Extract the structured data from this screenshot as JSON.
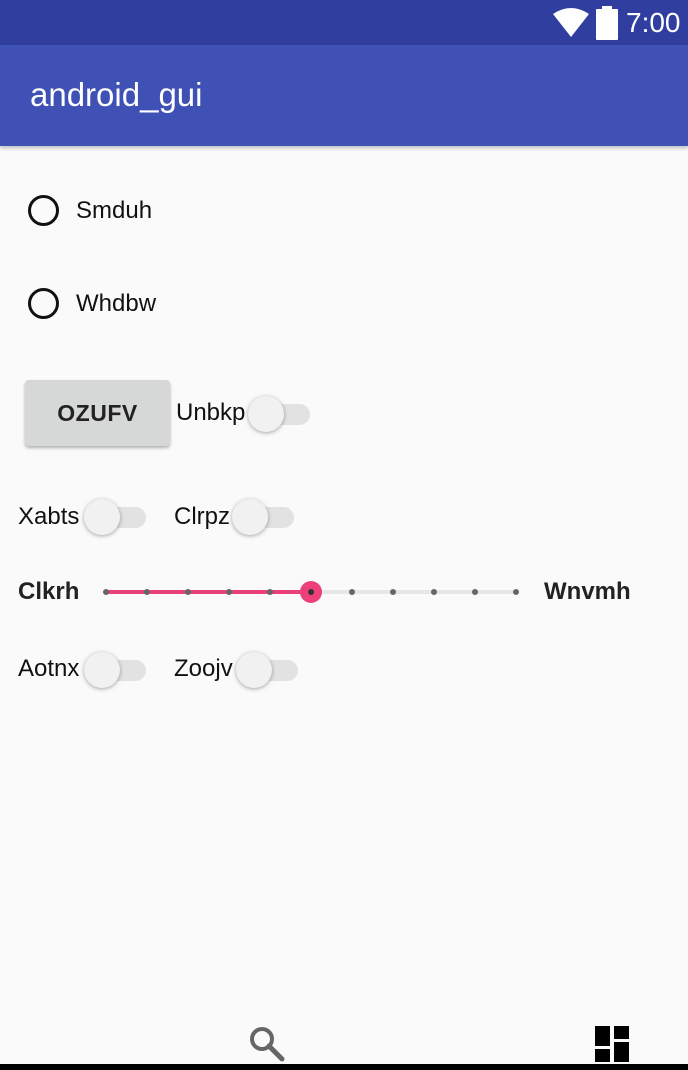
{
  "status_bar": {
    "time": "7:00"
  },
  "app_bar": {
    "title": "android_gui"
  },
  "radios": [
    {
      "label": "Smduh",
      "selected": false
    },
    {
      "label": "Whdbw",
      "selected": false
    }
  ],
  "button": {
    "label": "OZUFV"
  },
  "switches": {
    "unbkp": {
      "label": "Unbkp",
      "checked": false
    },
    "xabts": {
      "label": "Xabts",
      "checked": false
    },
    "clrpz": {
      "label": "Clrpz",
      "checked": false
    },
    "aotnx": {
      "label": "Aotnx",
      "checked": false
    },
    "zoojv": {
      "label": "Zoojv",
      "checked": false
    }
  },
  "slider": {
    "left_label": "Clkrh",
    "right_label": "Wnvmh",
    "value": 5,
    "max": 10,
    "color": "#ec407a"
  },
  "colors": {
    "status_bar": "#303f9f",
    "app_bar": "#3f51b5",
    "background": "#fafafa"
  },
  "bottom_nav": {
    "icons": [
      "search-icon",
      "dashboard-icon"
    ]
  }
}
